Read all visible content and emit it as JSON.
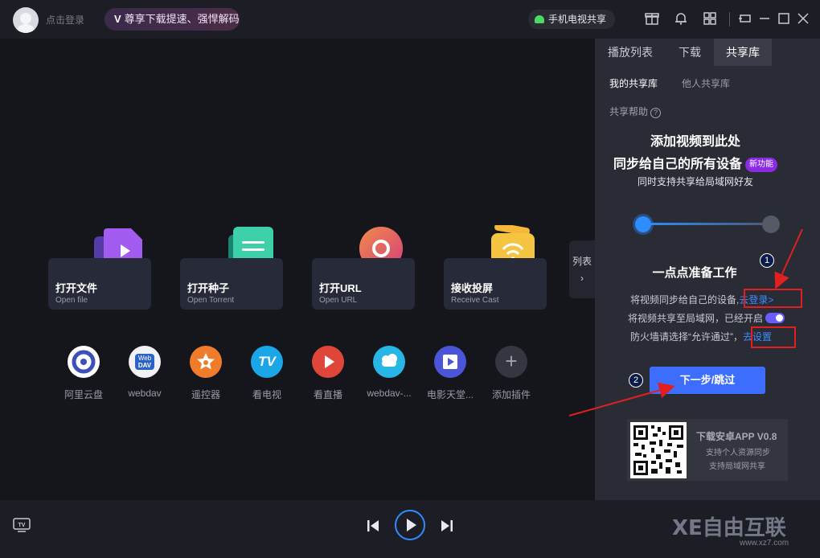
{
  "titlebar": {
    "login": "点击登录",
    "vip": "尊享下载提速、强悍解码",
    "vip_mark": "V",
    "tv_share": "手机电视共享"
  },
  "cards": [
    {
      "title": "打开文件",
      "sub": "Open file"
    },
    {
      "title": "打开种子",
      "sub": "Open Torrent"
    },
    {
      "title": "打开URL",
      "sub": "Open URL"
    },
    {
      "title": "接收投屏",
      "sub": "Receive Cast"
    }
  ],
  "plugins": [
    {
      "label": "阿里云盘",
      "color": "#3d4fb8"
    },
    {
      "label": "webdav",
      "color": "#e8e8ee"
    },
    {
      "label": "遥控器",
      "color": "#f07b2a"
    },
    {
      "label": "看电视",
      "color": "#1ba6e8"
    },
    {
      "label": "看直播",
      "color": "#e0453a"
    },
    {
      "label": "webdav-...",
      "color": "#27b6e6"
    },
    {
      "label": "电影天堂...",
      "color": "#4a55d8"
    },
    {
      "label": "添加插件",
      "color": "#35363f"
    }
  ],
  "plugin_texts": {
    "webdav_top": "Web",
    "webdav_bottom": "DAV",
    "tv": "TV",
    "add": "+"
  },
  "list_tab": {
    "label": "列表",
    "arrow": "›"
  },
  "panel": {
    "tabs": [
      "播放列表",
      "下载",
      "共享库"
    ],
    "subtabs": [
      "我的共享库",
      "他人共享库"
    ],
    "help": "共享帮助",
    "help_q": "?",
    "heading1": "添加视频到此处",
    "heading2": "同步给自己的所有设备",
    "badge": "新功能",
    "note": "同时支持共享给局域网好友",
    "ready": "一点点准备工作",
    "line1": "将视频同步给自己的设备,",
    "line1_link": "去登录>",
    "line2": "将视频共享至局域网，已经开启",
    "line3": "防火墙请选择“允许通过”，",
    "line3_link": "去设置",
    "next": "下一步/跳过",
    "qr_title": "下载安卓APP V0.8",
    "qr_sub1": "支持个人资源同步",
    "qr_sub2": "支持局域网共享"
  },
  "annotations": {
    "n1": "1",
    "n2": "2"
  },
  "watermark": {
    "main": "XE自由互联",
    "sub": "www.xz7.com"
  },
  "bottom": {
    "tv_label": "TV"
  }
}
